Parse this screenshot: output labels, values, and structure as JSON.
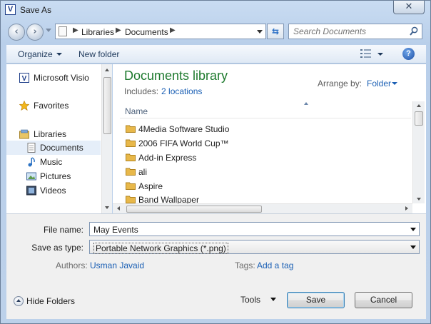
{
  "window": {
    "title": "Save As",
    "app_icon_letter": "V",
    "close_glyph": "✕"
  },
  "address": {
    "breadcrumbs": [
      "Libraries",
      "Documents"
    ],
    "search_placeholder": "Search Documents"
  },
  "toolbar": {
    "organize_label": "Organize",
    "new_folder_label": "New folder",
    "help_glyph": "?"
  },
  "nav_pane": {
    "items": [
      {
        "label": "Microsoft Visio",
        "icon": "visio-icon"
      },
      {
        "label": "Favorites",
        "icon": "star-icon"
      },
      {
        "label": "Libraries",
        "icon": "libraries-icon"
      },
      {
        "label": "Documents",
        "icon": "documents-icon",
        "selected": true
      },
      {
        "label": "Music",
        "icon": "music-icon"
      },
      {
        "label": "Pictures",
        "icon": "pictures-icon"
      },
      {
        "label": "Videos",
        "icon": "videos-icon"
      }
    ]
  },
  "content": {
    "library_title": "Documents library",
    "includes_label": "Includes:",
    "includes_link": "2 locations",
    "arrange_label": "Arrange by:",
    "arrange_value": "Folder",
    "column_name": "Name",
    "files": [
      "4Media Software Studio",
      "2006 FIFA World Cup™",
      "Add-in Express",
      "ali",
      "Aspire",
      "Band Wallpaper"
    ]
  },
  "details": {
    "file_name_label": "File name:",
    "file_name_value": "May Events",
    "save_type_label": "Save as type:",
    "save_type_value": "Portable Network Graphics (*.png)",
    "authors_label": "Authors:",
    "authors_value": "Usman Javaid",
    "tags_label": "Tags:",
    "tags_value": "Add a tag",
    "hide_folders_label": "Hide Folders",
    "tools_label": "Tools",
    "save_label": "Save",
    "cancel_label": "Cancel"
  },
  "colors": {
    "library_title": "#1e7a2e",
    "link": "#1a5fb4",
    "folder": "#e8b84a"
  }
}
